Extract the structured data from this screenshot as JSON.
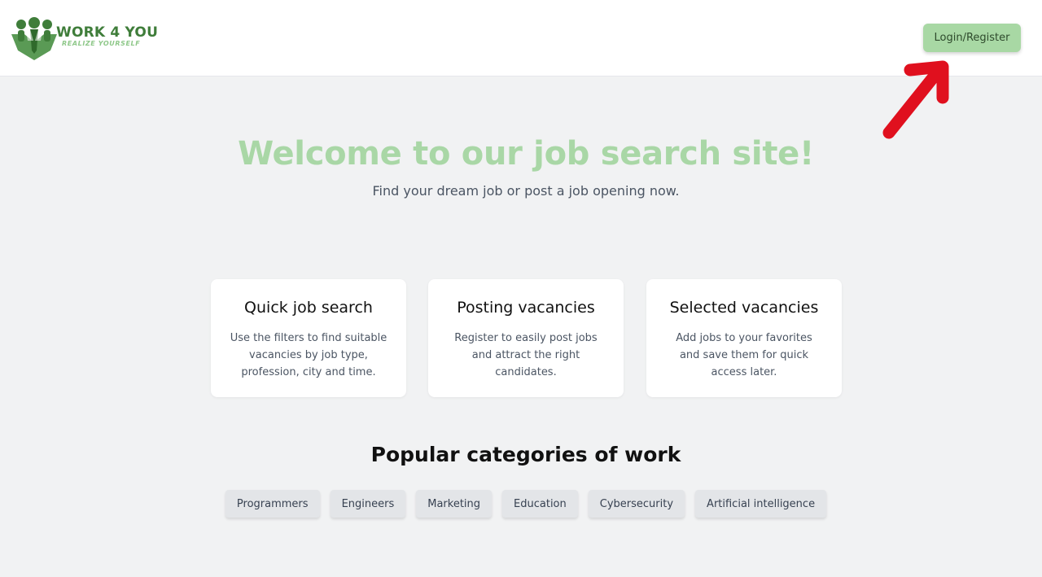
{
  "header": {
    "logo_title": "WORK 4 YOU",
    "logo_tagline": "REALIZE YOURSELF",
    "login_button": "Login/Register"
  },
  "hero": {
    "title": "Welcome to our job search site!",
    "subtitle": "Find your dream job or post a job opening now."
  },
  "features": [
    {
      "title": "Quick job search",
      "text": "Use the filters to find suitable vacancies by job type, profession, city and time."
    },
    {
      "title": "Posting vacancies",
      "text": "Register to easily post jobs and attract the right candidates."
    },
    {
      "title": "Selected vacancies",
      "text": "Add jobs to your favorites and save them for quick access later."
    }
  ],
  "categories": {
    "title": "Popular categories of work",
    "items": [
      "Programmers",
      "Engineers",
      "Marketing",
      "Education",
      "Cybersecurity",
      "Artificial intelligence"
    ]
  },
  "colors": {
    "brand_green": "#3f7d3a",
    "accent_light_green": "#a9d7a6",
    "annotation_red": "#e0101e"
  },
  "icons": {
    "logo_mark": "people-group-icon",
    "annotation": "red-arrow-pointer"
  }
}
